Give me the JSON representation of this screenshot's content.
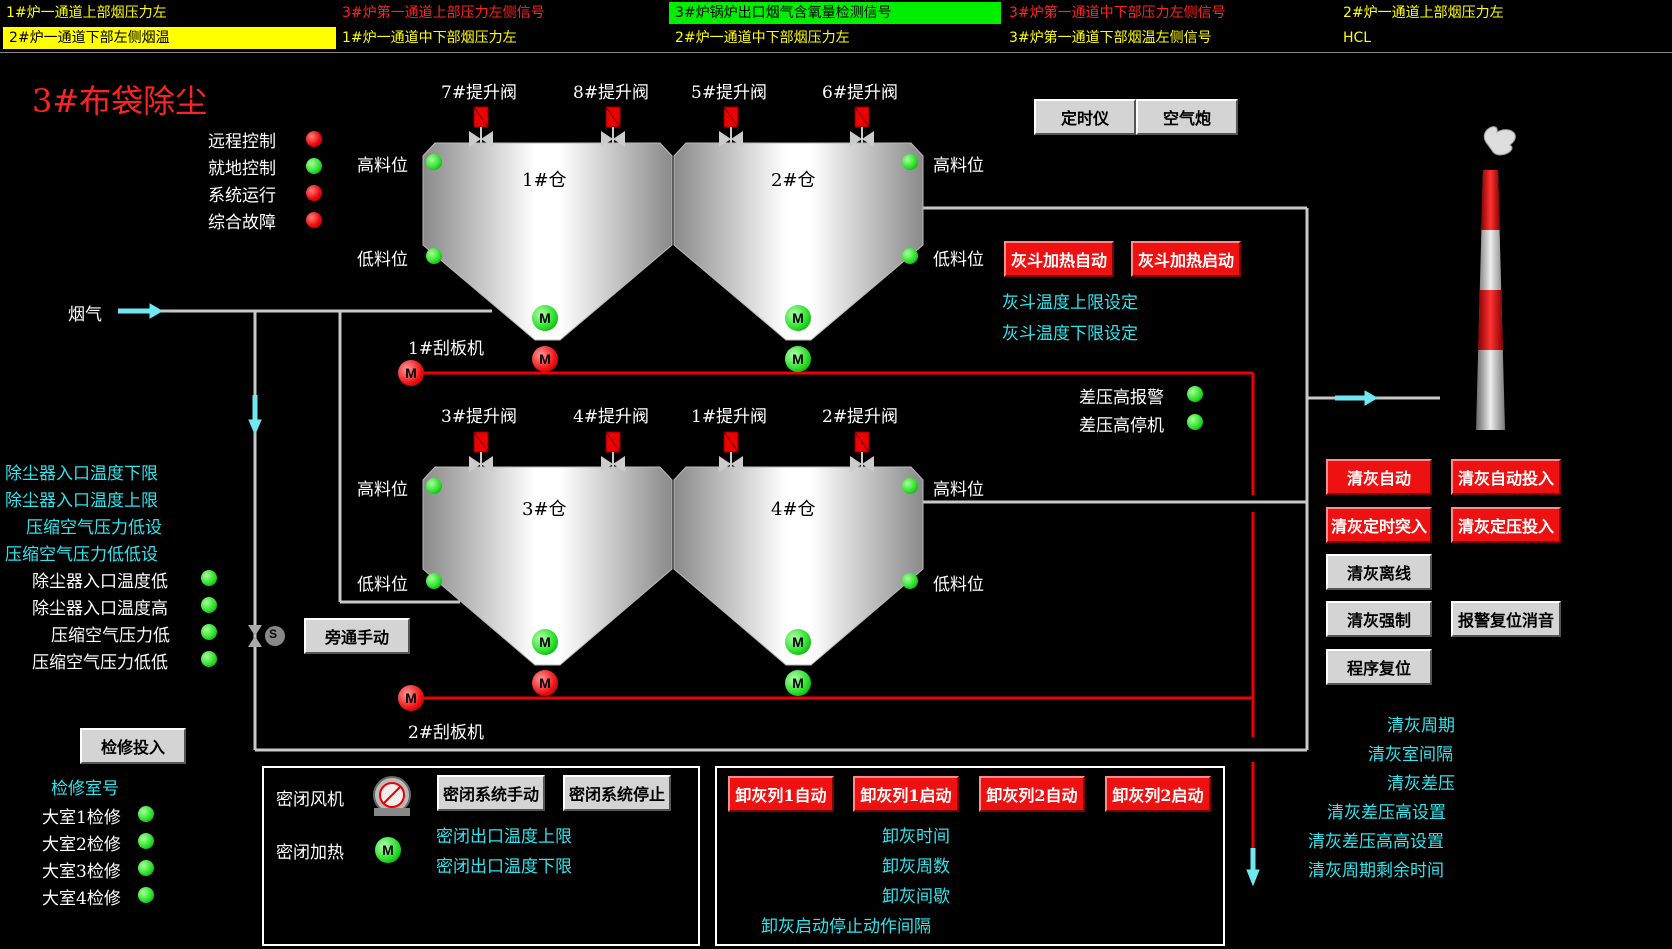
{
  "alarm_bar": {
    "row1": [
      {
        "text": "1#炉一通道上部烟压力左",
        "color": "#ffff00",
        "bg": "#000"
      },
      {
        "text": "3#炉第一通道上部压力左侧信号",
        "color": "#ff2222",
        "bg": "#000"
      },
      {
        "text": "3#炉锅炉出口烟气含氧量检测信号",
        "color": "#000000",
        "bg": "#00ee00"
      },
      {
        "text": "3#炉第一通道中下部压力左侧信号",
        "color": "#ff2222",
        "bg": "#000"
      },
      {
        "text": "2#炉一通道上部烟压力左",
        "color": "#ffff00",
        "bg": "#000"
      }
    ],
    "row2": [
      {
        "text": "2#炉一通道下部左侧烟温",
        "color": "#000000",
        "bg": "#ffff00"
      },
      {
        "text": "1#炉一通道中下部烟压力左",
        "color": "#ffff00",
        "bg": "#000"
      },
      {
        "text": "2#炉一通道中下部烟压力左",
        "color": "#ffff00",
        "bg": "#000"
      },
      {
        "text": "3#炉第一通道下部烟温左侧信号",
        "color": "#ffff00",
        "bg": "#000"
      },
      {
        "text": "HCL",
        "color": "#ffff00",
        "bg": "#000"
      }
    ]
  },
  "page_title": "3#布袋除尘",
  "status": [
    {
      "label": "远程控制",
      "state": "red"
    },
    {
      "label": "就地控制",
      "state": "green"
    },
    {
      "label": "系统运行",
      "state": "red"
    },
    {
      "label": "综合故障",
      "state": "red"
    }
  ],
  "top_buttons": {
    "timer": "定时仪",
    "air_cannon": "空气炮"
  },
  "upper_valves": [
    "7#提升阀",
    "8#提升阀",
    "5#提升阀",
    "6#提升阀"
  ],
  "lower_valves": [
    "3#提升阀",
    "4#提升阀",
    "1#提升阀",
    "2#提升阀"
  ],
  "silos": {
    "s1": "1#仓",
    "s2": "2#仓",
    "s3": "3#仓",
    "s4": "4#仓"
  },
  "level": {
    "high": "高料位",
    "low": "低料位"
  },
  "motor_letter": "M",
  "bypass_letter": "S",
  "flue_gas": "烟气",
  "scraper1": "1#刮板机",
  "scraper2": "2#刮板机",
  "hopper_heat": {
    "auto": "灰斗加热自动",
    "start": "灰斗加热启动",
    "upper": "灰斗温度上限设定",
    "lower": "灰斗温度下限设定"
  },
  "dp_alarms": [
    {
      "label": "差压高报警"
    },
    {
      "label": "差压高停机"
    }
  ],
  "left_settings": [
    "除尘器入口温度下限",
    "除尘器入口温度上限",
    "压缩空气压力低设",
    "压缩空气压力低低设"
  ],
  "left_alarms": [
    "除尘器入口温度低",
    "除尘器入口温度高",
    "压缩空气压力低",
    "压缩空气压力低低"
  ],
  "bypass_manual": "旁通手动",
  "maintenance": {
    "button": "检修投入",
    "room_no": "检修室号",
    "rooms": [
      "大室1检修",
      "大室2检修",
      "大室3检修",
      "大室4检修"
    ]
  },
  "seal": {
    "fan": "密闭风机",
    "heat": "密闭加热",
    "manual": "密闭系统手动",
    "stop": "密闭系统停止",
    "upper": "密闭出口温度上限",
    "lower": "密闭出口温度下限"
  },
  "unload": {
    "c1_auto": "卸灰列1自动",
    "c1_start": "卸灰列1启动",
    "c2_auto": "卸灰列2自动",
    "c2_start": "卸灰列2启动",
    "params": [
      "卸灰时间",
      "卸灰周数",
      "卸灰间歇",
      "卸灰启动停止动作间隔"
    ]
  },
  "clean": {
    "auto": "清灰自动",
    "auto_on": "清灰自动投入",
    "timed": "清灰定时突入",
    "pressure": "清灰定压投入",
    "offline": "清灰离线",
    "force": "清灰强制",
    "alarm_reset": "报警复位消音",
    "program_reset": "程序复位",
    "params": [
      "清灰周期",
      "清灰室间隔",
      "清灰差压",
      "清灰差压高设置",
      "清灰差压高高设置",
      "清灰周期剩余时间"
    ]
  },
  "colors": {
    "red_button": "#ee1111",
    "gray_button": "#d4d4d4",
    "cyan_text": "#2ee6ee",
    "pipe_gray": "#c8c8c8",
    "pipe_red": "#ee0000"
  }
}
